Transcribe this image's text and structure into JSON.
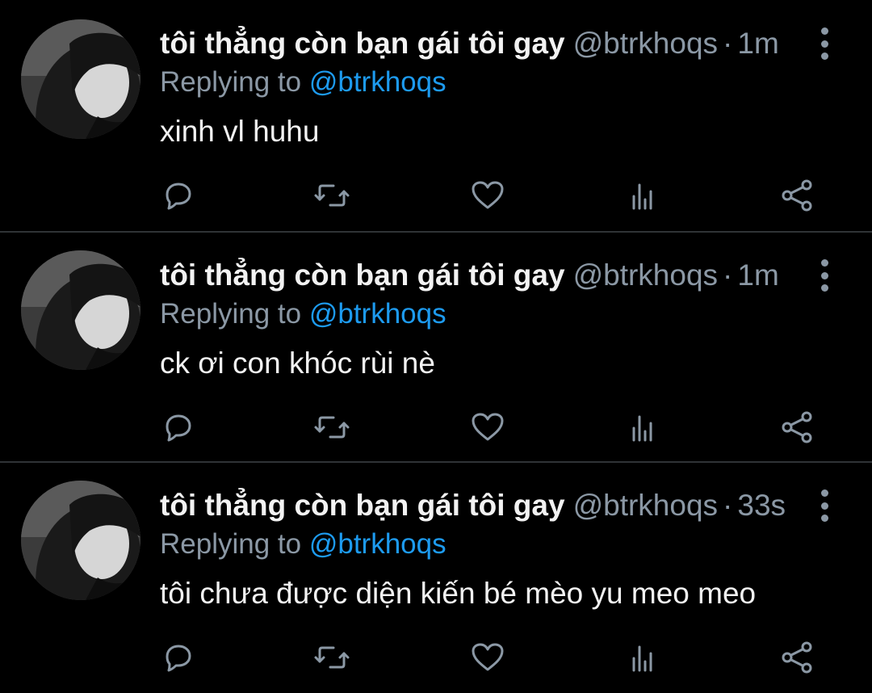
{
  "colors": {
    "background": "#000000",
    "name": "#f2f2f2",
    "muted": "#8b98a5",
    "link": "#1d9bf0",
    "divider": "#2f3336"
  },
  "icons": [
    "reply-icon",
    "retweet-icon",
    "like-icon",
    "analytics-icon",
    "share-icon",
    "more-icon"
  ],
  "tweets": [
    {
      "name": "tôi thẳng còn bạn gái tôi gay",
      "handle": "@btrkhoqs",
      "dot": "·",
      "time": "1m",
      "replying_prefix": "Replying to ",
      "replying_handle": "@btrkhoqs",
      "text": "xinh vl huhu"
    },
    {
      "name": "tôi thẳng còn bạn gái tôi gay",
      "handle": "@btrkhoqs",
      "dot": "·",
      "time": "1m",
      "replying_prefix": "Replying to ",
      "replying_handle": "@btrkhoqs",
      "text": "ck ơi con khóc rùi nè"
    },
    {
      "name": "tôi thẳng còn bạn gái tôi gay",
      "handle": "@btrkhoqs",
      "dot": "·",
      "time": "33s",
      "replying_prefix": "Replying to ",
      "replying_handle": "@btrkhoqs",
      "text": "tôi chưa được diện kiến bé mèo yu meo meo"
    }
  ]
}
